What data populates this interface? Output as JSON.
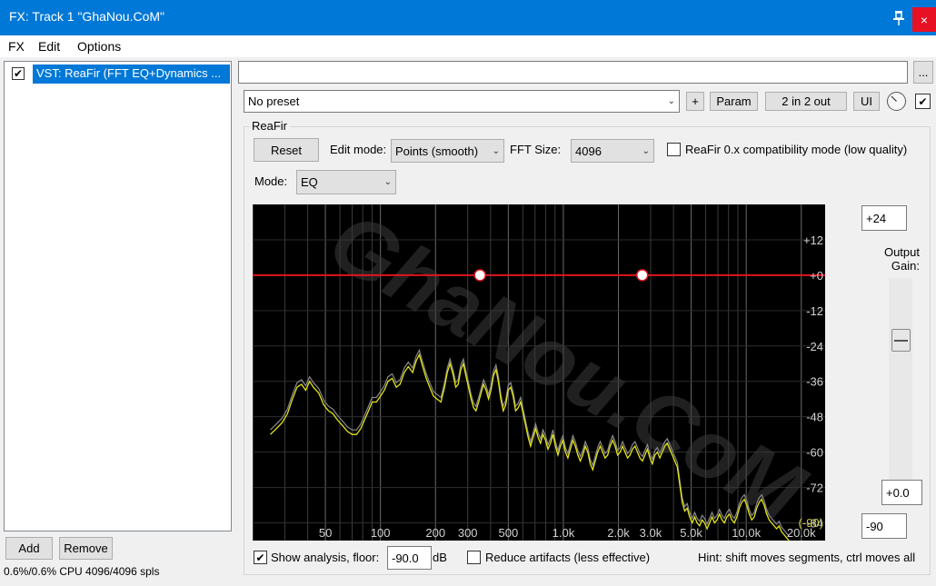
{
  "window": {
    "title": "FX: Track 1 \"GhaNou.CoM\"",
    "pin_icon": "pin-icon",
    "close_glyph": "×"
  },
  "menu": {
    "items": [
      "FX",
      "Edit",
      "Options"
    ]
  },
  "fx_list": {
    "items": [
      {
        "label": "VST: ReaFir (FFT EQ+Dynamics ...",
        "enabled": true,
        "selected": true
      }
    ],
    "add_label": "Add",
    "remove_label": "Remove",
    "cpu_status": "0.6%/0.6% CPU 4096/4096 spls"
  },
  "plugin_header": {
    "name_value": "",
    "more_label": "...",
    "preset": "No preset",
    "plus_label": "+",
    "param_label": "Param",
    "pins_label": "2 in 2 out",
    "ui_label": "UI",
    "enabled": true
  },
  "reafir": {
    "group_label": "ReaFir",
    "reset_label": "Reset",
    "edit_mode_label": "Edit mode:",
    "edit_mode_value": "Points (smooth)",
    "fft_size_label": "FFT Size:",
    "fft_size_value": "4096",
    "compat_label": "ReaFir 0.x compatibility mode (low quality)",
    "compat_checked": false,
    "mode_label": "Mode:",
    "mode_value": "EQ",
    "range_top": "+24",
    "range_bottom": "-90",
    "gain_label_1": "Output",
    "gain_label_2": "Gain:",
    "gain_value": "+0.0",
    "gain_level_db": 0,
    "show_analysis_label": "Show analysis, floor:",
    "show_analysis_checked": true,
    "floor_value": "-90.0",
    "db_unit": "dB",
    "reduce_label": "Reduce artifacts (less effective)",
    "reduce_checked": false,
    "hint": "Hint: shift moves segments, ctrl moves all"
  },
  "graph": {
    "freq_labels": [
      {
        "hz": 50,
        "label": "50"
      },
      {
        "hz": 100,
        "label": "100"
      },
      {
        "hz": 200,
        "label": "200"
      },
      {
        "hz": 300,
        "label": "300"
      },
      {
        "hz": 500,
        "label": "500"
      },
      {
        "hz": 1000,
        "label": "1.0k"
      },
      {
        "hz": 2000,
        "label": "2.0k"
      },
      {
        "hz": 3000,
        "label": "3.0k"
      },
      {
        "hz": 5000,
        "label": "5.0k"
      },
      {
        "hz": 10000,
        "label": "10.0k"
      },
      {
        "hz": 20000,
        "label": "20.0k"
      }
    ],
    "db_labels": [
      {
        "db": 12,
        "label": "+12"
      },
      {
        "db": 0,
        "label": "+0"
      },
      {
        "db": -12,
        "label": "-12"
      },
      {
        "db": -24,
        "label": "-24"
      },
      {
        "db": -36,
        "label": "-36"
      },
      {
        "db": -48,
        "label": "-48"
      },
      {
        "db": -60,
        "label": "-60"
      },
      {
        "db": -72,
        "label": "-72"
      },
      {
        "db": -84,
        "label": "-84"
      }
    ],
    "floor_label": "(-90)",
    "watermark": "GhaNou.CoM",
    "eq_points": [
      {
        "hz": 350,
        "db": 0
      },
      {
        "hz": 2700,
        "db": 0
      }
    ],
    "eq_line_db": 0,
    "analysis": [
      [
        25,
        -54
      ],
      [
        27,
        -52
      ],
      [
        29,
        -50
      ],
      [
        31,
        -47
      ],
      [
        33,
        -42
      ],
      [
        35,
        -38
      ],
      [
        37,
        -37
      ],
      [
        39,
        -39
      ],
      [
        41,
        -36
      ],
      [
        43,
        -38
      ],
      [
        46,
        -40
      ],
      [
        49,
        -44
      ],
      [
        52,
        -46
      ],
      [
        55,
        -47
      ],
      [
        58,
        -49
      ],
      [
        62,
        -51
      ],
      [
        66,
        -53
      ],
      [
        70,
        -54
      ],
      [
        74,
        -54
      ],
      [
        78,
        -52
      ],
      [
        82,
        -49
      ],
      [
        86,
        -46
      ],
      [
        90,
        -43
      ],
      [
        95,
        -43
      ],
      [
        100,
        -41
      ],
      [
        105,
        -39
      ],
      [
        110,
        -36
      ],
      [
        116,
        -35
      ],
      [
        122,
        -38
      ],
      [
        128,
        -37
      ],
      [
        135,
        -33
      ],
      [
        142,
        -31
      ],
      [
        150,
        -33
      ],
      [
        157,
        -29
      ],
      [
        163,
        -27
      ],
      [
        170,
        -31
      ],
      [
        178,
        -35
      ],
      [
        186,
        -38
      ],
      [
        195,
        -41
      ],
      [
        204,
        -42
      ],
      [
        214,
        -43
      ],
      [
        224,
        -38
      ],
      [
        232,
        -33
      ],
      [
        240,
        -30
      ],
      [
        250,
        -34
      ],
      [
        258,
        -38
      ],
      [
        266,
        -37
      ],
      [
        275,
        -32
      ],
      [
        284,
        -30
      ],
      [
        293,
        -34
      ],
      [
        303,
        -38
      ],
      [
        313,
        -42
      ],
      [
        323,
        -45
      ],
      [
        333,
        -46
      ],
      [
        344,
        -43
      ],
      [
        355,
        -40
      ],
      [
        366,
        -37
      ],
      [
        378,
        -39
      ],
      [
        390,
        -42
      ],
      [
        402,
        -39
      ],
      [
        415,
        -34
      ],
      [
        428,
        -32
      ],
      [
        441,
        -36
      ],
      [
        455,
        -42
      ],
      [
        469,
        -46
      ],
      [
        484,
        -44
      ],
      [
        499,
        -39
      ],
      [
        515,
        -38
      ],
      [
        531,
        -41
      ],
      [
        548,
        -46
      ],
      [
        566,
        -45
      ],
      [
        584,
        -43
      ],
      [
        603,
        -47
      ],
      [
        622,
        -51
      ],
      [
        642,
        -55
      ],
      [
        662,
        -58
      ],
      [
        683,
        -55
      ],
      [
        705,
        -52
      ],
      [
        727,
        -55
      ],
      [
        750,
        -57
      ],
      [
        774,
        -54
      ],
      [
        799,
        -56
      ],
      [
        824,
        -59
      ],
      [
        850,
        -57
      ],
      [
        877,
        -54
      ],
      [
        905,
        -58
      ],
      [
        934,
        -61
      ],
      [
        964,
        -58
      ],
      [
        994,
        -56
      ],
      [
        1026,
        -60
      ],
      [
        1058,
        -62
      ],
      [
        1092,
        -59
      ],
      [
        1127,
        -56
      ],
      [
        1163,
        -58
      ],
      [
        1200,
        -61
      ],
      [
        1238,
        -63
      ],
      [
        1277,
        -61
      ],
      [
        1318,
        -58
      ],
      [
        1360,
        -60
      ],
      [
        1403,
        -64
      ],
      [
        1448,
        -66
      ],
      [
        1494,
        -63
      ],
      [
        1541,
        -60
      ],
      [
        1590,
        -58
      ],
      [
        1641,
        -60
      ],
      [
        1693,
        -62
      ],
      [
        1747,
        -61
      ],
      [
        1803,
        -58
      ],
      [
        1860,
        -56
      ],
      [
        1919,
        -58
      ],
      [
        1980,
        -61
      ],
      [
        2043,
        -60
      ],
      [
        2108,
        -58
      ],
      [
        2175,
        -60
      ],
      [
        2244,
        -62
      ],
      [
        2315,
        -61
      ],
      [
        2389,
        -59
      ],
      [
        2465,
        -58
      ],
      [
        2543,
        -60
      ],
      [
        2624,
        -62
      ],
      [
        2707,
        -63
      ],
      [
        2793,
        -61
      ],
      [
        2882,
        -59
      ],
      [
        2974,
        -62
      ],
      [
        3068,
        -64
      ],
      [
        3166,
        -61
      ],
      [
        3266,
        -60
      ],
      [
        3370,
        -62
      ],
      [
        3477,
        -60
      ],
      [
        3588,
        -58
      ],
      [
        3702,
        -57
      ],
      [
        3819,
        -59
      ],
      [
        3941,
        -61
      ],
      [
        4066,
        -63
      ],
      [
        4195,
        -65
      ],
      [
        4328,
        -71
      ],
      [
        4466,
        -77
      ],
      [
        4608,
        -80
      ],
      [
        4754,
        -79
      ],
      [
        4905,
        -82
      ],
      [
        5061,
        -84
      ],
      [
        5222,
        -82
      ],
      [
        5388,
        -84
      ],
      [
        5559,
        -85
      ],
      [
        5736,
        -83
      ],
      [
        5918,
        -84
      ],
      [
        6106,
        -86
      ],
      [
        6300,
        -84
      ],
      [
        6500,
        -82
      ],
      [
        6707,
        -84
      ],
      [
        6920,
        -83
      ],
      [
        7140,
        -81
      ],
      [
        7367,
        -83
      ],
      [
        7601,
        -84
      ],
      [
        7842,
        -82
      ],
      [
        8091,
        -81
      ],
      [
        8348,
        -83
      ],
      [
        8613,
        -84
      ],
      [
        8887,
        -82
      ],
      [
        9169,
        -79
      ],
      [
        9460,
        -77
      ],
      [
        9761,
        -76
      ],
      [
        10071,
        -78
      ],
      [
        10391,
        -81
      ],
      [
        10721,
        -83
      ],
      [
        11062,
        -82
      ],
      [
        11413,
        -79
      ],
      [
        11776,
        -77
      ],
      [
        12150,
        -76
      ],
      [
        12536,
        -78
      ],
      [
        12934,
        -81
      ],
      [
        13345,
        -83
      ],
      [
        13769,
        -84
      ],
      [
        14207,
        -85
      ],
      [
        14658,
        -86
      ],
      [
        15124,
        -85
      ],
      [
        15605,
        -87
      ],
      [
        16101,
        -88
      ],
      [
        16612,
        -89
      ],
      [
        17140,
        -90
      ]
    ]
  }
}
